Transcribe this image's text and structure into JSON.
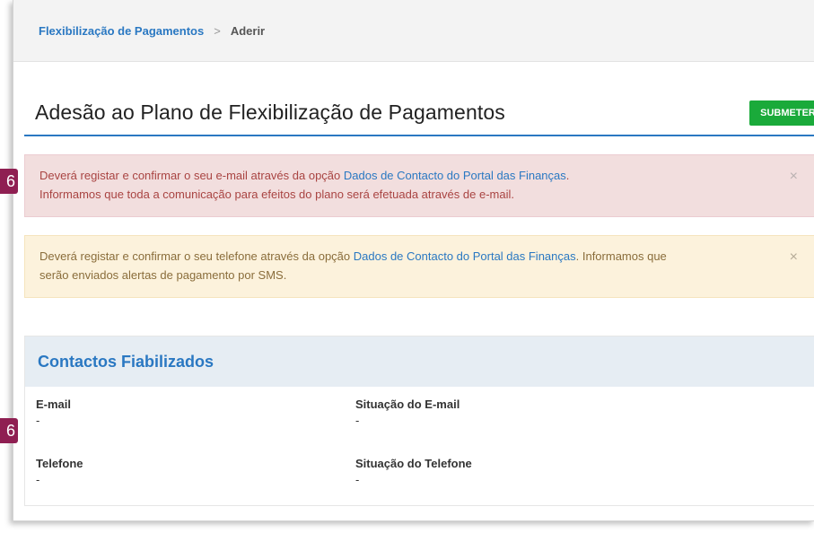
{
  "breadcrumb": {
    "link": "Flexibilização de Pagamentos",
    "separator": ">",
    "current": "Aderir"
  },
  "page": {
    "title": "Adesão ao Plano de Flexibilização de Pagamentos",
    "submit_label": "SUBMETER"
  },
  "alerts": {
    "email": {
      "text_before": "Deverá registar e confirmar o seu e-mail através da opção ",
      "link": "Dados de Contacto do Portal das Finanças",
      "text_after": ".",
      "line2": "Informamos que toda a comunicação para efeitos do plano será efetuada através de e-mail.",
      "close": "×"
    },
    "phone": {
      "text_before": "Deverá registar e confirmar o seu telefone através da opção ",
      "link": "Dados de Contacto do Portal das Finanças",
      "text_after": ". Informamos que",
      "line2": "serão enviados alertas de pagamento por SMS.",
      "close": "×"
    }
  },
  "contacts": {
    "title": "Contactos Fiabilizados",
    "fields": [
      {
        "label": "E-mail",
        "value": "-"
      },
      {
        "label": "Situação do E-mail",
        "value": "-"
      },
      {
        "label": "Telefone",
        "value": "-"
      },
      {
        "label": "Situação do Telefone",
        "value": "-"
      }
    ]
  },
  "badges": [
    "6",
    "6"
  ],
  "colors": {
    "accent": "#2a78c2",
    "submit": "#1aaa3a",
    "danger_bg": "#f2dede",
    "warning_bg": "#fcf2dc",
    "badge": "#8f1f52"
  }
}
